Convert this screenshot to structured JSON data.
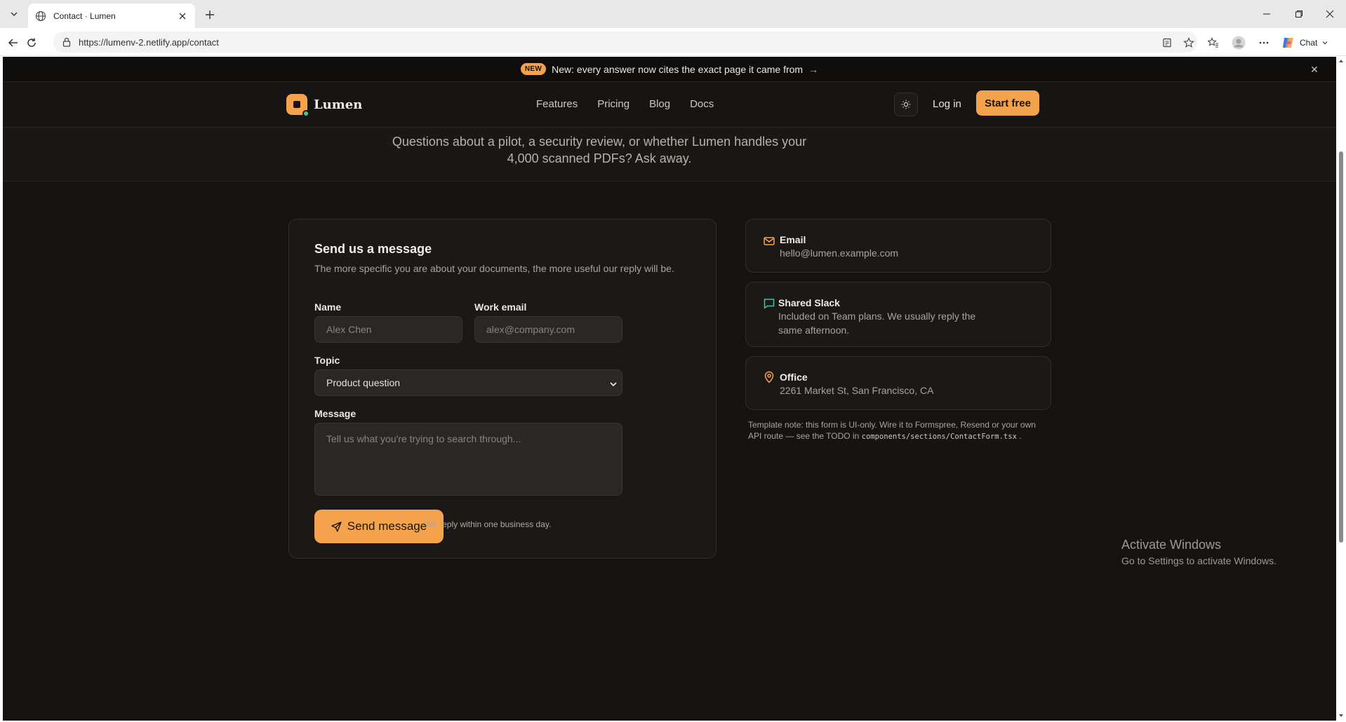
{
  "browser": {
    "tab_title": "Contact · Lumen",
    "url": "https://lumenv-2.netlify.app/contact",
    "chat_label": "Chat"
  },
  "announcement": {
    "badge": "NEW",
    "message": "New: every answer now cites the exact page it came from",
    "arrow": "→",
    "close": "✕"
  },
  "nav": {
    "brand": "Lumen",
    "links": [
      "Features",
      "Pricing",
      "Blog",
      "Docs"
    ],
    "login": "Log in",
    "cta": "Start free"
  },
  "hero": {
    "subtitle_line1": "Questions about a pilot, a security review, or whether Lumen handles your",
    "subtitle_line2": "4,000 scanned PDFs? Ask away."
  },
  "form": {
    "title": "Send us a message",
    "description": "The more specific you are about your documents, the more useful our reply will be.",
    "name_label": "Name",
    "name_placeholder": "Alex Chen",
    "email_label": "Work email",
    "email_placeholder": "alex@company.com",
    "topic_label": "Topic",
    "topic_value": "Product question",
    "message_label": "Message",
    "message_placeholder": "Tell us what you're trying to search through...",
    "submit": "Send message",
    "reply_note": "We reply within one business day."
  },
  "contacts": [
    {
      "icon": "mail-icon",
      "title": "Email",
      "value": "hello@lumen.example.com"
    },
    {
      "icon": "chat-icon",
      "title": "Shared Slack",
      "value": "Included on Team plans. We usually reply the same afternoon."
    },
    {
      "icon": "location-pin-icon",
      "title": "Office",
      "value": "2261 Market St, San Francisco, CA"
    }
  ],
  "template_note": {
    "text": "Template note: this form is UI-only. Wire it to Formspree, Resend or your own API route — see the TODO in",
    "code": "components/sections/ContactForm.tsx",
    "end": "."
  },
  "watermark": {
    "line1": "Activate Windows",
    "line2": "Go to Settings to activate Windows."
  },
  "colors": {
    "accent": "#f4a24c",
    "background": "#161413",
    "teal": "#3ec7a4"
  }
}
